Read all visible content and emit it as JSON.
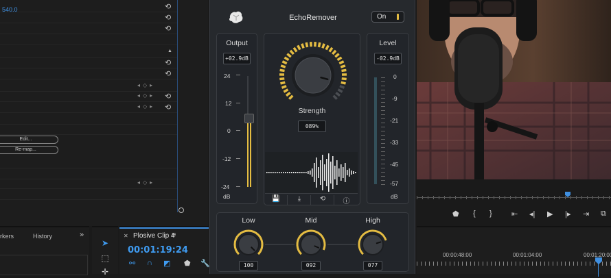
{
  "effect_controls": {
    "param_value": "540.0",
    "edit_button": "Edit...",
    "remap_button": "Re-map..."
  },
  "panels": {
    "markers_tab": "rkers",
    "history_tab": "History",
    "more": "»"
  },
  "timeline": {
    "sequence_name": "Plosive Clip 4",
    "timecode": "00:01:19:24",
    "ruler": [
      "00:00:48:00",
      "00:01:04:00",
      "00:01:20:00"
    ]
  },
  "plugin": {
    "title": "EchoRemover",
    "power_label": "On",
    "output": {
      "label": "Output",
      "value": "+02.9dB",
      "scale": [
        "24",
        "12",
        "0",
        "-12",
        "-24"
      ],
      "unit": "dB",
      "fader_level": 0.62
    },
    "strength": {
      "label": "Strength",
      "value": "089%",
      "percent": 89
    },
    "level": {
      "label": "Level",
      "value": "-02.9dB",
      "scale": [
        "0",
        "-9",
        "-21",
        "-33",
        "-45",
        "-57"
      ],
      "unit": "dB"
    },
    "eq": [
      {
        "label": "Low",
        "value": "100"
      },
      {
        "label": "Mid",
        "value": "092"
      },
      {
        "label": "High",
        "value": "077"
      }
    ],
    "toolbar_icons": [
      "save-icon",
      "export-icon",
      "undo-icon",
      "info-icon"
    ],
    "accent_color": "#e4bc42"
  }
}
